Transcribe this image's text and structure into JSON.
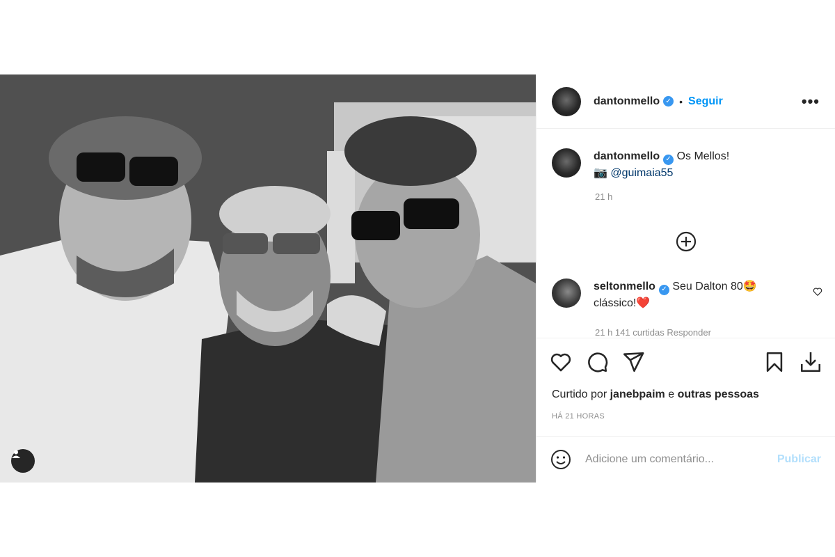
{
  "post": {
    "author": "dantonmello",
    "follow_label": "Seguir",
    "dot": "•",
    "more": "•••",
    "caption": {
      "author": "dantonmello",
      "text": "Os Mellos!",
      "credit_emoji": "📷",
      "credit": "@guimaia55",
      "time": "21 h"
    },
    "comments": [
      {
        "author": "seltonmello",
        "line1": "Seu Dalton 80🤩",
        "line2": "clássico!❤️",
        "meta": "21 h   141 curtidas   Responder"
      }
    ],
    "likes_prefix": "Curtido por",
    "likes_user": "janebpaim",
    "likes_and": "e",
    "likes_others": "outras pessoas",
    "posted_ago": "HÁ 21 HORAS",
    "add_comment_placeholder": "Adicione um comentário...",
    "publish_label": "Publicar"
  },
  "icons": [
    "verified-icon",
    "more-options-icon",
    "add-circle-icon",
    "like-heart-icon",
    "comment-icon",
    "share-icon",
    "save-bookmark-icon",
    "download-icon",
    "emoji-icon",
    "tag-user-icon"
  ],
  "colors": {
    "accent": "#0095f6",
    "verified": "#3897f0",
    "publish_disabled": "#b2dffc",
    "heart": "#ed4956"
  }
}
